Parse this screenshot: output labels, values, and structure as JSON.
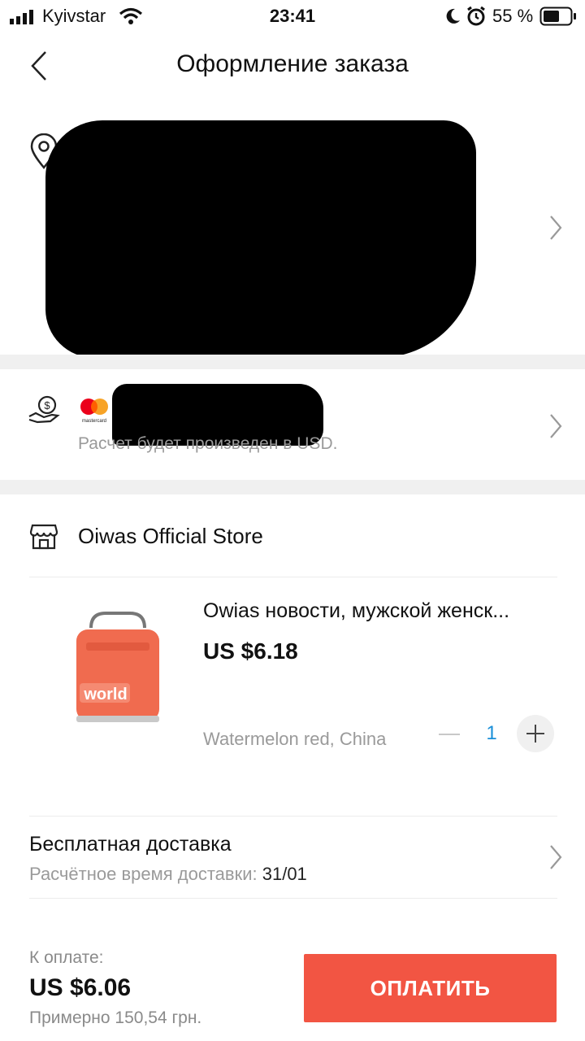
{
  "status_bar": {
    "carrier": "Kyivstar",
    "time": "23:41",
    "battery_percent": "55 %"
  },
  "header": {
    "title": "Оформление заказа",
    "back_icon": "chevron-left-icon"
  },
  "address": {
    "icon": "location-pin-icon",
    "redacted": true
  },
  "payment": {
    "icon": "hand-coin-icon",
    "card_brand": "mastercard",
    "note": "Расчет будет произведен в USD."
  },
  "store": {
    "icon": "store-icon",
    "name": "Oiwas Official Store"
  },
  "product": {
    "title": "Owias новости, мужской женск...",
    "price": "US $6.18",
    "variant": "Watermelon red, China",
    "quantity": "1",
    "image_text": "world",
    "image_color": "#f06b4f"
  },
  "shipping": {
    "title": "Бесплатная доставка",
    "eta_label": "Расчётное время доставки:",
    "eta_value": "31/01"
  },
  "footer": {
    "total_label": "К оплате:",
    "total_amount": "US $6.06",
    "approx": "Примерно 150,54 грн.",
    "pay_button": "ОПЛАТИТЬ",
    "accent": "#f25543"
  }
}
